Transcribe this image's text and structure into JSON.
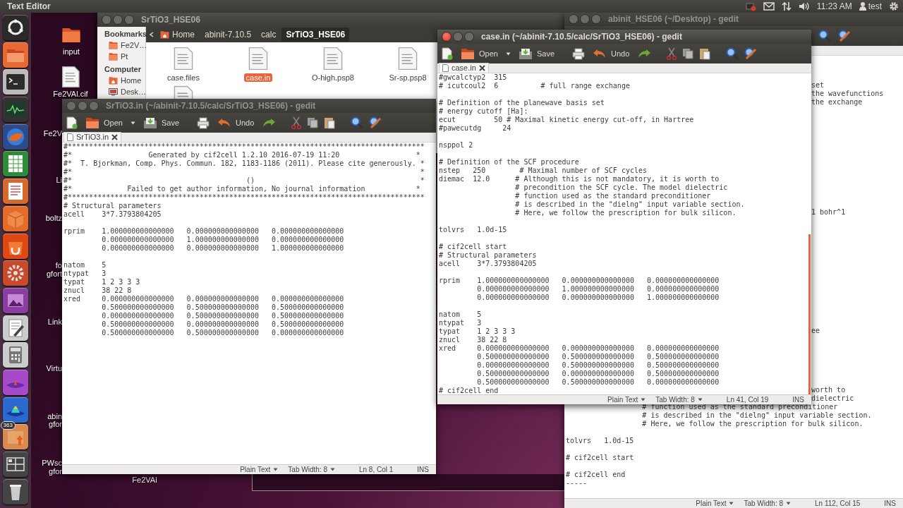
{
  "top_panel": {
    "app_name": "Text Editor",
    "clock": "11:23 AM",
    "user": "test"
  },
  "launcher": {
    "badge": "363"
  },
  "desktop_icons": [
    {
      "kind": "folder",
      "label": "input"
    },
    {
      "kind": "file",
      "label": "Fe2VAl.cif"
    },
    {
      "kind": "clipped",
      "label": "Fe2V"
    },
    {
      "kind": "clipped",
      "label": "Li"
    },
    {
      "kind": "clipped",
      "label": "boltz"
    },
    {
      "kind": "clipped",
      "label": "fo"
    },
    {
      "kind": "clipped",
      "label": "gfort"
    },
    {
      "kind": "clipped",
      "label": "Link"
    },
    {
      "kind": "clipped",
      "label": "Virtu"
    },
    {
      "kind": "clipped",
      "label": "abin"
    },
    {
      "kind": "clipped",
      "label": "gfor"
    },
    {
      "kind": "clipped",
      "label": "PWsc"
    },
    {
      "kind": "clipped",
      "label": "gfor"
    },
    {
      "kind": "label",
      "label": "Fe2VAl"
    }
  ],
  "file_manager": {
    "title": "SrTiO3_HSE06",
    "sidebar": [
      {
        "heading": "Bookmarks",
        "items": [
          {
            "kind": "folder",
            "label": "Fe2V…"
          },
          {
            "kind": "folder",
            "label": "Pt"
          }
        ]
      },
      {
        "heading": "Computer",
        "items": [
          {
            "kind": "home",
            "label": "Home"
          },
          {
            "kind": "desktop",
            "label": "Desk…"
          }
        ]
      }
    ],
    "path": [
      {
        "label": "Home",
        "selected": false
      },
      {
        "label": "abinit-7.10.5",
        "selected": false
      },
      {
        "label": "calc",
        "selected": false
      },
      {
        "label": "SrTiO3_HSE06",
        "selected": true
      }
    ],
    "files": [
      {
        "name": "case.files",
        "selected": false
      },
      {
        "name": "case.in",
        "selected": true
      },
      {
        "name": "O-high.psp8",
        "selected": false
      },
      {
        "name": "Sr-sp.psp8",
        "selected": false
      },
      {
        "selected": false
      }
    ]
  },
  "gedit_windows": [
    {
      "title": "abinit_HSE06 (~/Desktop) - gedit",
      "active": false,
      "lines": [
        {
          "kind": "blank"
        },
        {
          "kind": "blank"
        },
        {
          "kind": "blank"
        },
        {
          "kind": "clipped",
          "text": "set"
        },
        {
          "kind": "clipped",
          "text": "the wavefunctions"
        },
        {
          "kind": "clipped",
          "text": "the exchange"
        },
        {
          "kind": "blank"
        },
        {
          "kind": "blank"
        },
        {
          "kind": "blank"
        },
        {
          "kind": "blank"
        },
        {
          "kind": "blank"
        },
        {
          "kind": "blank"
        },
        {
          "kind": "blank"
        },
        {
          "kind": "blank"
        },
        {
          "kind": "blank"
        },
        {
          "kind": "blank"
        },
        {
          "kind": "blank"
        },
        {
          "kind": "blank"
        },
        {
          "kind": "clipped",
          "text": "1 bohr^1"
        },
        {
          "kind": "blank"
        },
        {
          "kind": "blank"
        },
        {
          "kind": "blank"
        },
        {
          "kind": "blank"
        },
        {
          "kind": "blank"
        },
        {
          "kind": "blank"
        },
        {
          "kind": "blank"
        },
        {
          "kind": "blank"
        },
        {
          "kind": "blank"
        },
        {
          "kind": "blank"
        },
        {
          "kind": "blank"
        },
        {
          "kind": "blank"
        },
        {
          "kind": "blank"
        },
        {
          "kind": "clipped",
          "text": "ee"
        },
        {
          "kind": "blank"
        },
        {
          "kind": "blank"
        },
        {
          "kind": "blank"
        },
        {
          "kind": "blank"
        },
        {
          "kind": "blank"
        },
        {
          "kind": "blank"
        },
        {
          "kind": "clipped",
          "text": "worth to"
        },
        {
          "kind": "clipped",
          "text": "dielectric"
        },
        {
          "kind": "code",
          "text": "                  # function used as the standard preconditioner"
        },
        {
          "kind": "code",
          "text": "                  # is described in the \"dielng\" input variable section."
        },
        {
          "kind": "code",
          "text": "                  # Here, we follow the prescription for bulk silicon."
        },
        {
          "kind": "blank"
        },
        {
          "kind": "code",
          "text": "tolvrs   1.0d-15"
        },
        {
          "kind": "blank"
        },
        {
          "kind": "code",
          "text": "# cif2cell start"
        },
        {
          "kind": "blank"
        },
        {
          "kind": "code",
          "text": "# cif2cell end"
        },
        {
          "kind": "code",
          "text": "-----"
        }
      ],
      "status": {
        "language": "Plain Text",
        "tab_width": "Tab Width: 8",
        "position": "Ln 112, Col 15",
        "mode": "INS"
      }
    },
    {
      "title": "SrTiO3.in (~/abinit-7.10.5/calc/SrTiO3_HSE06) - gedit",
      "active": false,
      "toolbar": {
        "open": "Open",
        "save": "Save",
        "undo": "Undo"
      },
      "tab": "SrTiO3.in",
      "lines": [
        {
          "kind": "code",
          "text": "#************************************************************************************"
        },
        {
          "kind": "code",
          "text": "#*                  Generated by cif2cell 1.2.10 2016-07-19 11:20                  *"
        },
        {
          "kind": "code",
          "text": "#*  T. Bjorkman, Comp. Phys. Commun. 182, 1183-1186 (2011). Please cite generously. *"
        },
        {
          "kind": "code",
          "text": "#*                                                                                  *"
        },
        {
          "kind": "code",
          "text": "#*                                         ()                                       *"
        },
        {
          "kind": "code",
          "text": "#*             Failed to get author information, No journal information            *"
        },
        {
          "kind": "code",
          "text": "#************************************************************************************"
        },
        {
          "kind": "code",
          "text": "# Structural parameters"
        },
        {
          "kind": "code",
          "text": "acell    3*7.3793804205"
        },
        {
          "kind": "blank"
        },
        {
          "kind": "code",
          "text": "rprim    1.000000000000000   0.000000000000000   0.000000000000000"
        },
        {
          "kind": "code",
          "text": "         0.000000000000000   1.000000000000000   0.000000000000000"
        },
        {
          "kind": "code",
          "text": "         0.000000000000000   0.000000000000000   1.000000000000000"
        },
        {
          "kind": "blank"
        },
        {
          "kind": "code",
          "text": "natom    5"
        },
        {
          "kind": "code",
          "text": "ntypat   3"
        },
        {
          "kind": "code",
          "text": "typat    1 2 3 3 3"
        },
        {
          "kind": "code",
          "text": "znucl    38 22 8"
        },
        {
          "kind": "code",
          "text": "xred     0.000000000000000   0.000000000000000   0.000000000000000"
        },
        {
          "kind": "code",
          "text": "         0.500000000000000   0.500000000000000   0.500000000000000"
        },
        {
          "kind": "code",
          "text": "         0.000000000000000   0.500000000000000   0.500000000000000"
        },
        {
          "kind": "code",
          "text": "         0.500000000000000   0.000000000000000   0.500000000000000"
        },
        {
          "kind": "code",
          "text": "         0.500000000000000   0.500000000000000   0.000000000000000"
        }
      ],
      "status": {
        "language": "Plain Text",
        "tab_width": "Tab Width: 8",
        "position": "Ln 8, Col 1",
        "mode": "INS"
      }
    },
    {
      "title": "case.in (~/abinit-7.10.5/calc/SrTiO3_HSE06) - gedit",
      "active": true,
      "toolbar": {
        "open": "Open",
        "save": "Save",
        "undo": "Undo"
      },
      "tab": "case.in",
      "lines": [
        {
          "kind": "code",
          "text": "#gwcalctyp2  315"
        },
        {
          "kind": "code",
          "text": "# icutcoul2  6          # full range exchange"
        },
        {
          "kind": "blank"
        },
        {
          "kind": "code",
          "text": "# Definition of the planewave basis set"
        },
        {
          "kind": "code",
          "text": "# energy cutoff [Ha]:"
        },
        {
          "kind": "code",
          "text": "ecut         50 # Maximal kinetic energy cut-off, in Hartree"
        },
        {
          "kind": "code",
          "text": "#pawecutdg     24"
        },
        {
          "kind": "blank"
        },
        {
          "kind": "code",
          "text": "nsppol 2"
        },
        {
          "kind": "blank"
        },
        {
          "kind": "code",
          "text": "# Definition of the SCF procedure"
        },
        {
          "kind": "code",
          "text": "nstep   250        # Maximal number of SCF cycles"
        },
        {
          "kind": "code",
          "text": "diemac  12.0      # Although this is not mandatory, it is worth to"
        },
        {
          "kind": "code",
          "text": "                  # precondition the SCF cycle. The model dielectric"
        },
        {
          "kind": "code",
          "text": "                  # function used as the standard preconditioner"
        },
        {
          "kind": "code",
          "text": "                  # is described in the \"dielng\" input variable section."
        },
        {
          "kind": "code",
          "text": "                  # Here, we follow the prescription for bulk silicon."
        },
        {
          "kind": "blank"
        },
        {
          "kind": "code",
          "text": "tolvrs   1.0d-15"
        },
        {
          "kind": "blank"
        },
        {
          "kind": "code",
          "text": "# cif2cell start"
        },
        {
          "kind": "code",
          "text": "# Structural parameters"
        },
        {
          "kind": "code",
          "text": "acell    3*7.3793804205"
        },
        {
          "kind": "blank"
        },
        {
          "kind": "code",
          "text": "rprim    1.000000000000000   0.000000000000000   0.000000000000000"
        },
        {
          "kind": "code",
          "text": "         0.000000000000000   1.000000000000000   0.000000000000000"
        },
        {
          "kind": "code",
          "text": "         0.000000000000000   0.000000000000000   1.000000000000000"
        },
        {
          "kind": "blank"
        },
        {
          "kind": "code",
          "text": "natom    5"
        },
        {
          "kind": "code",
          "text": "ntypat   3"
        },
        {
          "kind": "code",
          "text": "typat    1 2 3 3 3"
        },
        {
          "kind": "code",
          "text": "znucl    38 22 8"
        },
        {
          "kind": "code",
          "text": "xred     0.000000000000000   0.000000000000000   0.000000000000000"
        },
        {
          "kind": "code",
          "text": "         0.500000000000000   0.500000000000000   0.500000000000000"
        },
        {
          "kind": "code",
          "text": "         0.000000000000000   0.500000000000000   0.500000000000000"
        },
        {
          "kind": "code",
          "text": "         0.500000000000000   0.000000000000000   0.500000000000000"
        },
        {
          "kind": "code",
          "text": "         0.500000000000000   0.500000000000000   0.000000000000000"
        },
        {
          "kind": "code",
          "text": "# cif2cell end"
        }
      ],
      "status": {
        "language": "Plain Text",
        "tab_width": "Tab Width: 8",
        "position": "Ln 41, Col 19",
        "mode": "INS"
      }
    }
  ]
}
